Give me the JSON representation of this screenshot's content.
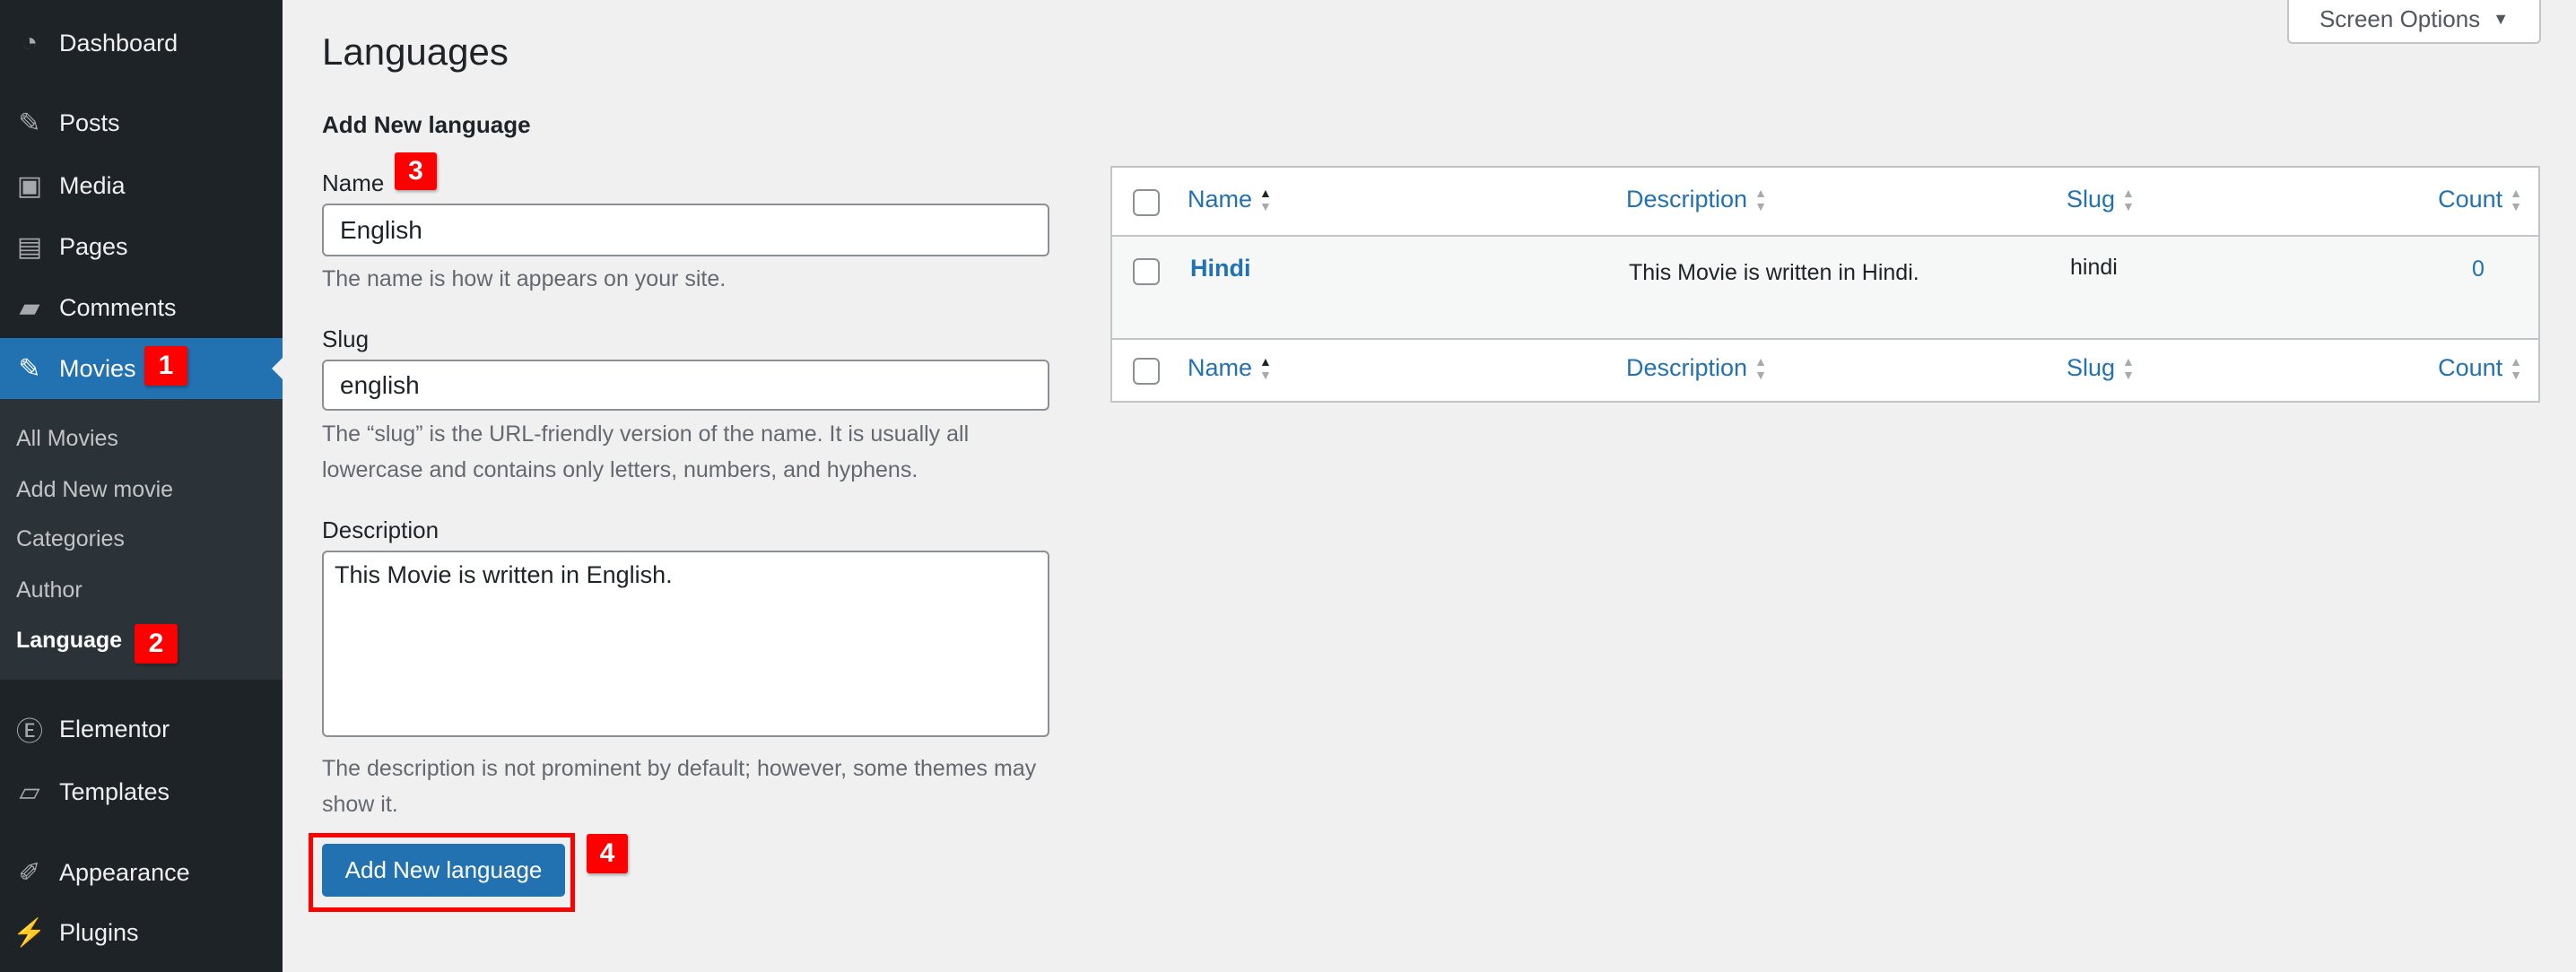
{
  "sidebar": {
    "items": [
      {
        "label": "Dashboard",
        "icon": "dashboard-icon",
        "glyph": "◔"
      },
      {
        "label": "Posts",
        "icon": "pin-icon",
        "glyph": "✎"
      },
      {
        "label": "Media",
        "icon": "media-icon",
        "glyph": "▣"
      },
      {
        "label": "Pages",
        "icon": "pages-icon",
        "glyph": "▤"
      },
      {
        "label": "Comments",
        "icon": "comment-icon",
        "glyph": "▰"
      },
      {
        "label": "Movies",
        "icon": "pin-icon",
        "glyph": "✎"
      },
      {
        "label": "Elementor",
        "icon": "elementor-icon",
        "glyph": "Ⓔ"
      },
      {
        "label": "Templates",
        "icon": "folder-icon",
        "glyph": "▱"
      },
      {
        "label": "Appearance",
        "icon": "brush-icon",
        "glyph": "✐"
      },
      {
        "label": "Plugins",
        "icon": "plug-icon",
        "glyph": "⚡"
      }
    ],
    "submenu": [
      "All Movies",
      "Add New movie",
      "Categories",
      "Author",
      "Language"
    ]
  },
  "badges": [
    "1",
    "2",
    "3",
    "4"
  ],
  "screen_options": "Screen Options",
  "page_title": "Languages",
  "form": {
    "heading": "Add New language",
    "name_label": "Name",
    "name_value": "English",
    "name_help": "The name is how it appears on your site.",
    "slug_label": "Slug",
    "slug_value": "english",
    "slug_help": "The “slug” is the URL-friendly version of the name. It is usually all lowercase and contains only letters, numbers, and hyphens.",
    "desc_label": "Description",
    "desc_value": "This Movie is written in English.",
    "desc_help": "The description is not prominent by default; however, some themes may show it.",
    "submit": "Add New language"
  },
  "table": {
    "columns": [
      "Name",
      "Description",
      "Slug",
      "Count"
    ],
    "rows": [
      {
        "name": "Hindi",
        "description": "This Movie is written in Hindi.",
        "slug": "hindi",
        "count": "0"
      }
    ]
  },
  "colors": {
    "accent": "#2271b1",
    "sidebar": "#1d2327",
    "annotation": "#ff0000"
  }
}
